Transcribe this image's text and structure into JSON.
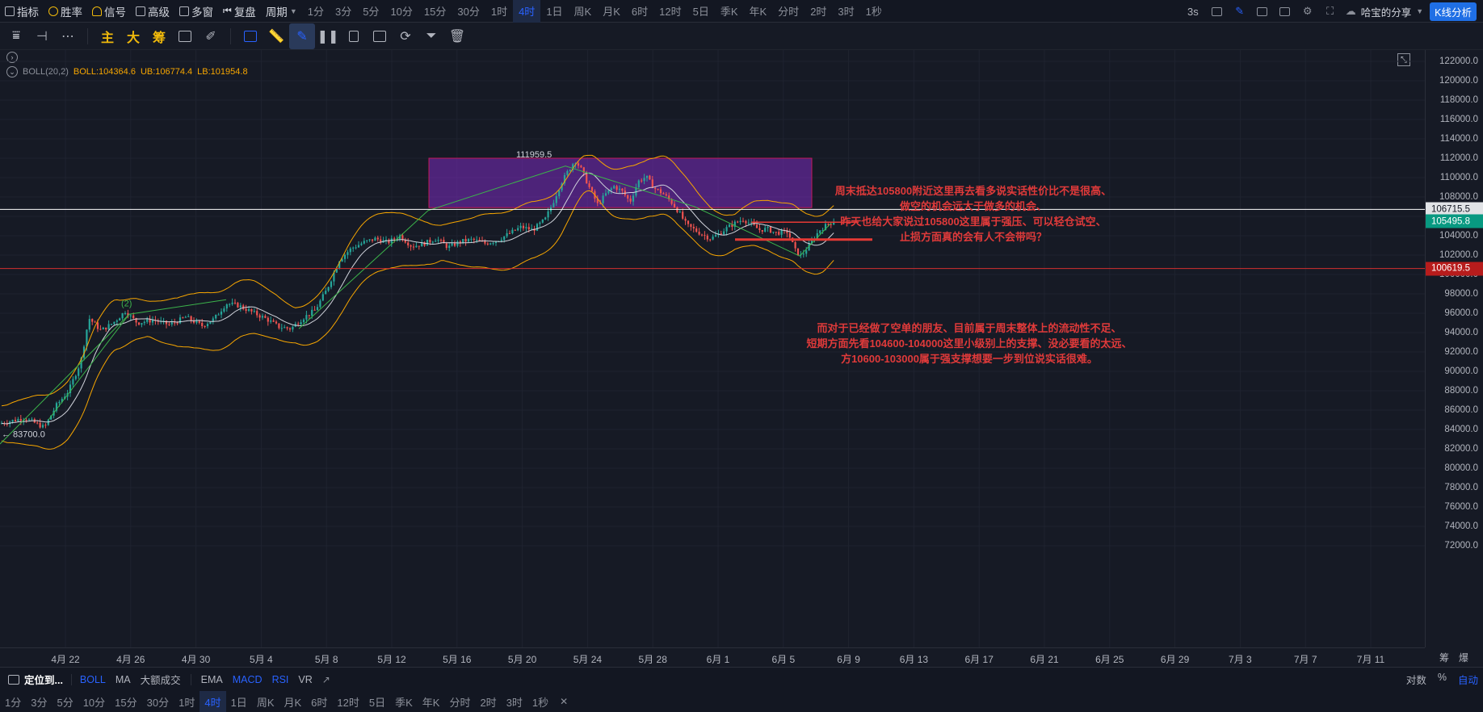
{
  "topbar": {
    "items": [
      {
        "label": "指标",
        "icon": "indicator-icon"
      },
      {
        "label": "胜率",
        "icon": "winrate-icon"
      },
      {
        "label": "信号",
        "icon": "signal-icon"
      },
      {
        "label": "高级",
        "icon": "advanced-icon"
      },
      {
        "label": "多窗",
        "icon": "multiwindow-icon"
      },
      {
        "label": "复盘",
        "icon": "replay-icon"
      },
      {
        "label": "周期",
        "icon": "chevron-down-icon"
      }
    ],
    "periods": [
      "1分",
      "3分",
      "5分",
      "10分",
      "15分",
      "30分",
      "1时",
      "4时",
      "1日",
      "周K",
      "月K",
      "6时",
      "12时",
      "5日",
      "季K",
      "年K",
      "分时",
      "2时",
      "3时",
      "1秒"
    ],
    "active_period": "4时",
    "interval": "3s",
    "share_label": "哈宝的分享",
    "kline_button": "K线分析"
  },
  "toolbar2": {
    "cn_tools": [
      "主",
      "大",
      "筹"
    ]
  },
  "legend": {
    "name": "BOLL(20,2)",
    "boll": "BOLL:104364.6",
    "ub": "UB:106774.4",
    "lb": "LB:101954.8"
  },
  "chart_data": {
    "type": "candlestick",
    "indicator": "BOLL(20,2)",
    "ylim": [
      71000,
      123000
    ],
    "y_ticks": [
      122000,
      120000,
      118000,
      116000,
      114000,
      112000,
      110000,
      108000,
      106000,
      104000,
      102000,
      100000,
      98000,
      96000,
      94000,
      92000,
      90000,
      88000,
      86000,
      84000,
      82000,
      80000,
      78000,
      76000,
      74000,
      72000
    ],
    "x_ticks": [
      "4月 22",
      "4月 26",
      "4月 30",
      "5月 4",
      "5月 8",
      "5月 12",
      "5月 16",
      "5月 20",
      "5月 24",
      "5月 28",
      "6月 1",
      "6月 5",
      "6月 9",
      "6月 13",
      "6月 17",
      "6月 21",
      "6月 25",
      "6月 29",
      "7月 3",
      "7月 7",
      "7月 11"
    ],
    "price_labels": {
      "high_label": "111959.5",
      "low_label": "← 83700.0",
      "wave_label": "(2)"
    },
    "badges": [
      {
        "value": "106715.5",
        "bg": "#e1e3e6",
        "fg": "#131722",
        "y": 106715.5
      },
      {
        "value": "105495.8",
        "bg": "#089981",
        "fg": "#ffffff",
        "y": 105495.8
      },
      {
        "value": "100619.5",
        "bg": "#b71c1c",
        "fg": "#ffffff",
        "y": 100619.5
      }
    ],
    "horizontal_lines": [
      {
        "y": 106715.5,
        "color": "#ffffff"
      },
      {
        "y": 100619.5,
        "color": "#d32f2f"
      }
    ],
    "zone": {
      "y_top": 112000,
      "y_bottom": 106900,
      "color": "#7b2cbf"
    }
  },
  "annotations": {
    "top": [
      "周末抵达105800附近这里再去看多说实话性价比不是很高、",
      "做空的机会远大于做多的机会、",
      "昨天也给大家说过105800这里属于强压、可以轻仓试空、",
      "止损方面真的会有人不会带吗？"
    ],
    "bottom": [
      "而对于已经做了空单的朋友、目前属于周末整体上的流动性不足、",
      "短期方面先看104600-104000这里小级别上的支撑、没必要看的太远、",
      "方10600-103000属于强支撑想要一步到位说实话很难。"
    ]
  },
  "xaxis_corner": [
    "筹",
    "爆"
  ],
  "bottombar": {
    "locate": "定位到...",
    "items": [
      "BOLL",
      "MA",
      "大额成交",
      "EMA",
      "MACD",
      "RSI",
      "VR"
    ],
    "active_items": [
      "BOLL",
      "MACD",
      "RSI"
    ],
    "right": [
      "对数",
      "%",
      "自动"
    ]
  },
  "periodbar": {
    "periods": [
      "1分",
      "3分",
      "5分",
      "10分",
      "15分",
      "30分",
      "1时",
      "4时",
      "1日",
      "周K",
      "月K",
      "6时",
      "12时",
      "5日",
      "季K",
      "年K",
      "分时",
      "2时",
      "3时",
      "1秒"
    ],
    "active": "4时"
  }
}
